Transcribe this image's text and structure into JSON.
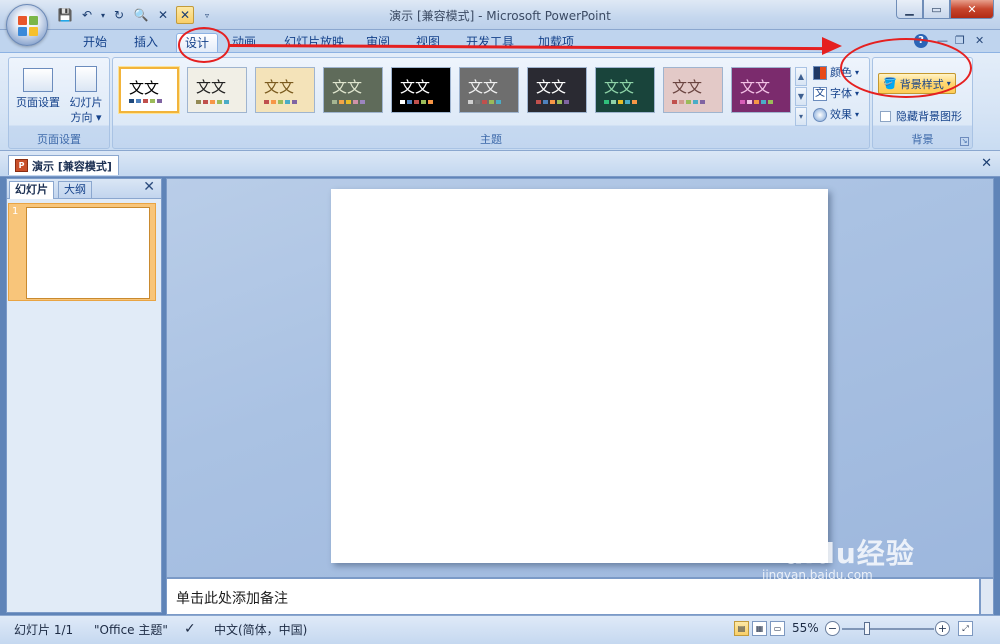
{
  "window": {
    "title": "演示 [兼容模式] - Microsoft PowerPoint"
  },
  "tabs": [
    {
      "label": "开始"
    },
    {
      "label": "插入"
    },
    {
      "label": "设计"
    },
    {
      "label": "动画"
    },
    {
      "label": "幻灯片放映"
    },
    {
      "label": "审阅"
    },
    {
      "label": "视图"
    },
    {
      "label": "开发工具"
    },
    {
      "label": "加载项"
    }
  ],
  "ribbon": {
    "page_setup": {
      "group_label": "页面设置",
      "page_setup_label": "页面设置",
      "orientation_label_1": "幻灯片",
      "orientation_label_2": "方向 ▾"
    },
    "themes": {
      "group_label": "主题",
      "items": [
        {
          "text": "文文",
          "bg": "#ffffff",
          "fg": "#000000"
        },
        {
          "text": "文文",
          "bg": "#f1efe6",
          "fg": "#222222"
        },
        {
          "text": "文文",
          "bg": "#f4e3b9",
          "fg": "#7a5a1e"
        },
        {
          "text": "文文",
          "bg": "#5f6b5a",
          "fg": "#e0e6cf"
        },
        {
          "text": "文文",
          "bg": "#000000",
          "fg": "#ffffff"
        },
        {
          "text": "文文",
          "bg": "#6e6e6e",
          "fg": "#f0f0f0"
        },
        {
          "text": "文文",
          "bg": "#2a2a32",
          "fg": "#ffffff"
        },
        {
          "text": "文文",
          "bg": "#19443b",
          "fg": "#8fd3a8"
        },
        {
          "text": "文文",
          "bg": "#e3c9c7",
          "fg": "#6a4440"
        },
        {
          "text": "文文",
          "bg": "#7b2b6d",
          "fg": "#f3c2e6"
        }
      ],
      "colors_label": "颜色",
      "fonts_label": "字体",
      "effects_label": "效果"
    },
    "background": {
      "group_label": "背景",
      "bg_styles_label": "背景样式",
      "hide_bg_label": "隐藏背景图形"
    }
  },
  "document_tab": {
    "label": "演示 [兼容模式]"
  },
  "left_panel": {
    "tab_slides": "幻灯片",
    "tab_outline": "大纲",
    "slide_number": "1"
  },
  "notes": {
    "placeholder": "单击此处添加备注"
  },
  "status": {
    "slide_info": "幻灯片 1/1",
    "theme": "\"Office 主题\"",
    "language": "中文(简体，中国)",
    "zoom": "55%"
  },
  "watermark": {
    "main": "Baidu经验",
    "sub": "jingyan.baidu.com"
  },
  "colors": {
    "accent_red": "#e52020",
    "ribbon_bg": "#dbe7f6",
    "workspace_bg": "#a9c1e3"
  }
}
